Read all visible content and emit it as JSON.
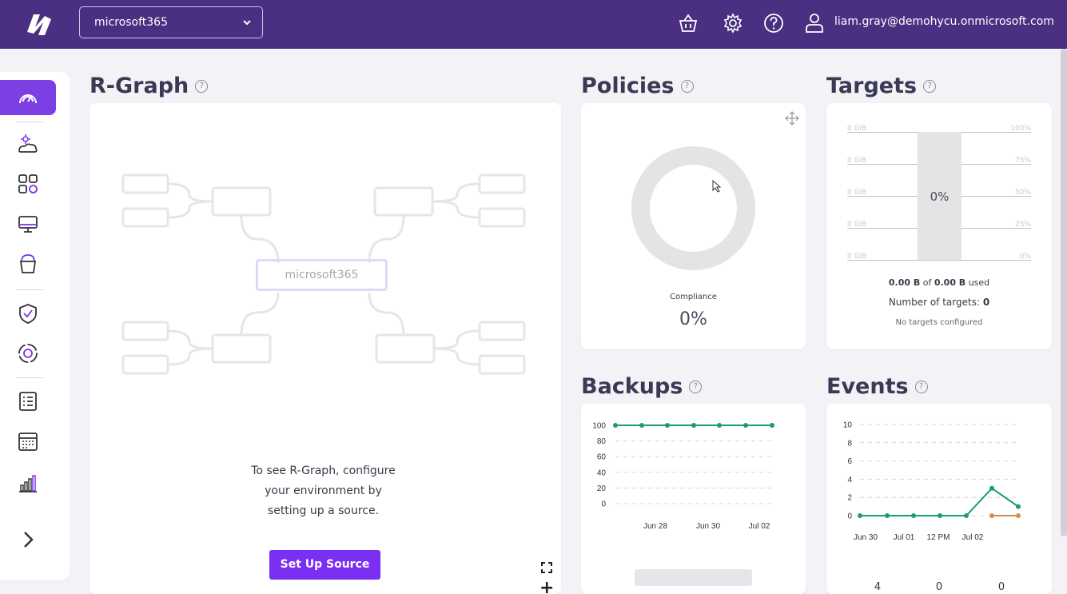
{
  "header": {
    "tenant": "microsoft365",
    "user_email": "liam.gray@demohycu.onmicrosoft.com",
    "icons": [
      "basket-icon",
      "gear-icon",
      "help-icon",
      "user-icon"
    ]
  },
  "sidebar": {
    "items": [
      {
        "name": "dashboard",
        "icon": "gauge-icon",
        "active": true
      },
      {
        "name": "cloud-settings",
        "icon": "cloud-gear-icon"
      },
      {
        "name": "applications",
        "icon": "grid-icon"
      },
      {
        "name": "devices",
        "icon": "monitor-icon"
      },
      {
        "name": "buckets",
        "icon": "bucket-icon"
      },
      {
        "name": "policies",
        "icon": "shield-check-icon"
      },
      {
        "name": "protection",
        "icon": "target-ring-icon"
      },
      {
        "name": "jobs",
        "icon": "list-icon"
      },
      {
        "name": "calendar",
        "icon": "calendar-icon"
      },
      {
        "name": "reports",
        "icon": "bar-chart-icon"
      },
      {
        "name": "expand",
        "icon": "chevron-right-icon"
      }
    ]
  },
  "rgraph": {
    "title": "R-Graph",
    "center_label": "microsoft365",
    "message": "To see R-Graph, configure your environment by setting up a source.",
    "button_label": "Set Up Source"
  },
  "policies": {
    "title": "Policies",
    "compliance_label": "Compliance",
    "compliance_value": "0%"
  },
  "targets": {
    "title": "Targets",
    "left_ticks": [
      "0 GiB",
      "0 GiB",
      "0 GiB",
      "0 GiB",
      "0 GiB"
    ],
    "right_ticks": [
      "100%",
      "75%",
      "50%",
      "25%",
      "0%"
    ],
    "bar_label": "0%",
    "used_amount": "0.00 B",
    "used_of": "of",
    "total_amount": "0.00 B",
    "used_suffix": "used",
    "count_label": "Number of targets:",
    "count_value": "0",
    "none_message": "No targets configured"
  },
  "backups": {
    "title": "Backups"
  },
  "events": {
    "title": "Events",
    "counts": [
      "4",
      "0",
      "0"
    ]
  },
  "colors": {
    "topbar": "#4a2f82",
    "accent": "#7b2ff2",
    "series_green": "#1a9e6e",
    "series_orange": "#d98c4a"
  },
  "chart_data": [
    {
      "type": "line",
      "chart": "backups",
      "yticks": [
        0,
        20,
        40,
        60,
        80,
        100
      ],
      "ylim": [
        0,
        100
      ],
      "xticks": [
        "Jun 28",
        "Jun 30",
        "Jul 02"
      ],
      "series": [
        {
          "values": [
            100,
            100,
            100,
            100,
            100,
            100,
            100
          ]
        }
      ],
      "grid": true
    },
    {
      "type": "line",
      "chart": "events",
      "yticks": [
        0,
        2,
        4,
        6,
        8,
        10
      ],
      "ylim": [
        0,
        10
      ],
      "xticks": [
        "Jun 30",
        "Jul 01",
        "12 PM",
        "Jul 02"
      ],
      "series": [
        {
          "values": [
            0,
            0,
            0,
            0,
            0,
            3,
            1
          ]
        },
        {
          "values": [
            0,
            0
          ]
        }
      ],
      "grid": true
    }
  ]
}
